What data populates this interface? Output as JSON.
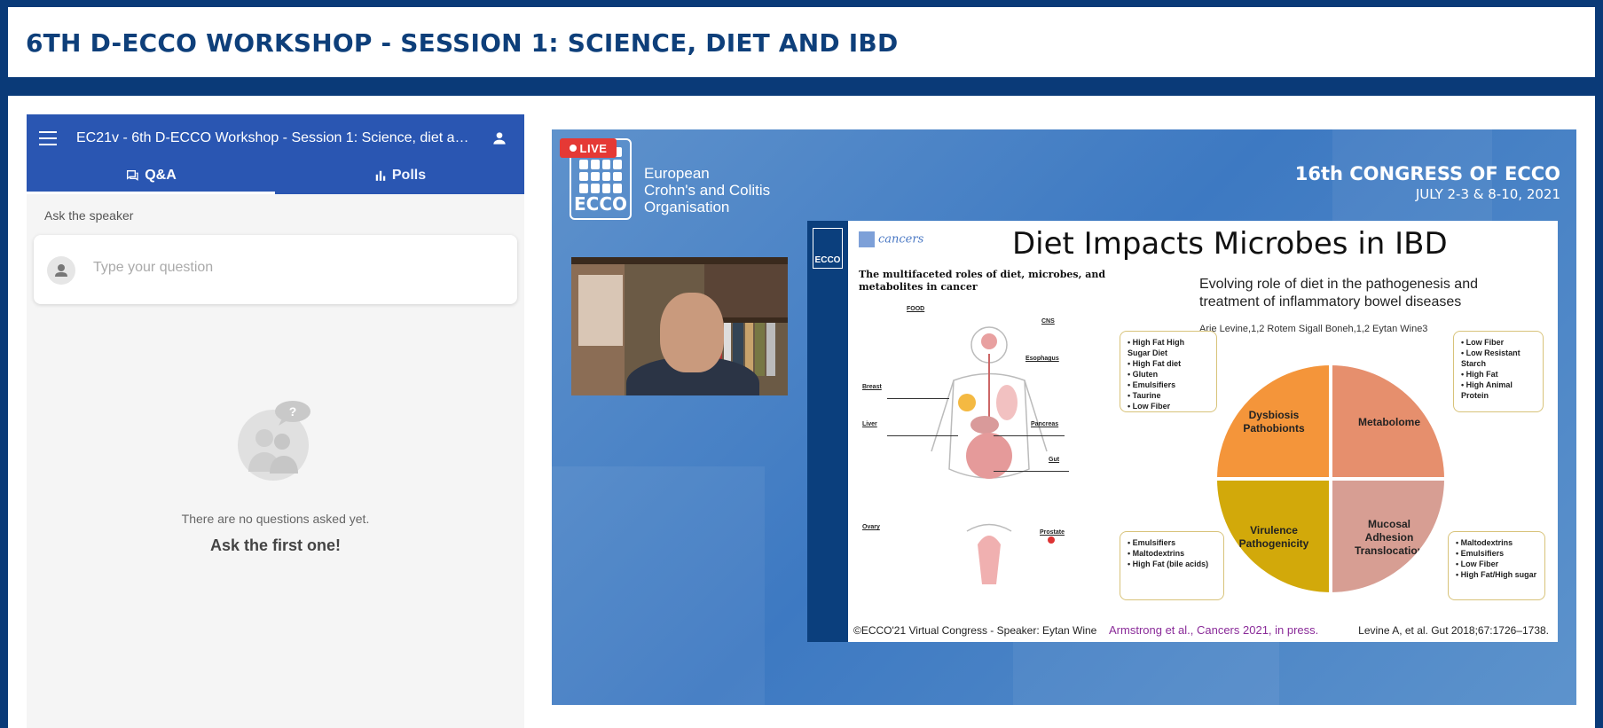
{
  "header": {
    "title": "6TH D-ECCO WORKSHOP - SESSION 1: SCIENCE, DIET AND IBD"
  },
  "panel": {
    "title": "EC21v - 6th D-ECCO Workshop - Session 1: Science, diet and IBD",
    "tabs": [
      {
        "label": "Q&A",
        "icon": "chat-icon"
      },
      {
        "label": "Polls",
        "icon": "bar-chart-icon"
      }
    ],
    "active_tab": "Q&A",
    "ask_label": "Ask the speaker",
    "question_placeholder": "Type your question",
    "empty_text": "There are no questions asked yet.",
    "empty_cta": "Ask the first one!"
  },
  "video": {
    "live_label": "LIVE",
    "live_color": "#e53935",
    "org_logo_text": "ECCO",
    "org_name": "European\nCrohn's and Colitis\nOrganisation",
    "congress_title": "16th CONGRESS OF ECCO",
    "congress_date": "JULY 2-3 & 8-10, 2021",
    "slide": {
      "logo_text": "ECCO",
      "journal": "cancers",
      "title": "Diet Impacts Microbes in IBD",
      "paper1_title": "The multifaceted roles of diet, microbes, and metabolites in cancer",
      "paper2_title": "Evolving role of diet in the pathogenesis and treatment of inflammatory bowel diseases",
      "paper2_authors": "Arie Levine,1,2 Rotem Sigall Boneh,1,2 Eytan Wine3",
      "organs": [
        "FOOD",
        "CNS",
        "Esophagus",
        "Breast",
        "Liver",
        "Pancreas",
        "Gut",
        "Ovary",
        "Prostate"
      ],
      "wheel": {
        "top_left": "Dysbiosis\nPathobionts",
        "top_right": "Metabolome",
        "bottom_left": "Virulence\nPathogenicity",
        "bottom_right": "Mucosal\nAdhesion\nTranslocation"
      },
      "factors_top_left": [
        "High Fat High Sugar Diet",
        "High Fat diet",
        "Gluten",
        "Emulsifiers",
        "Taurine",
        "Low Fiber"
      ],
      "factors_top_right": [
        "Low Fiber",
        "Low Resistant Starch",
        "High Fat",
        "High Animal Protein"
      ],
      "factors_bottom_left": [
        "Emulsifiers",
        "Maltodextrins",
        "High Fat (bile acids)"
      ],
      "factors_bottom_right": [
        "Maltodextrins",
        "Emulsifiers",
        "Low Fiber",
        "High Fat/High sugar"
      ],
      "footer_left": "©ECCO'21 Virtual Congress - Speaker: Eytan Wine",
      "footer_mid": "Armstrong et al., Cancers 2021, in press.",
      "footer_right": "Levine A, et al. Gut 2018;67:1726–1738."
    }
  }
}
